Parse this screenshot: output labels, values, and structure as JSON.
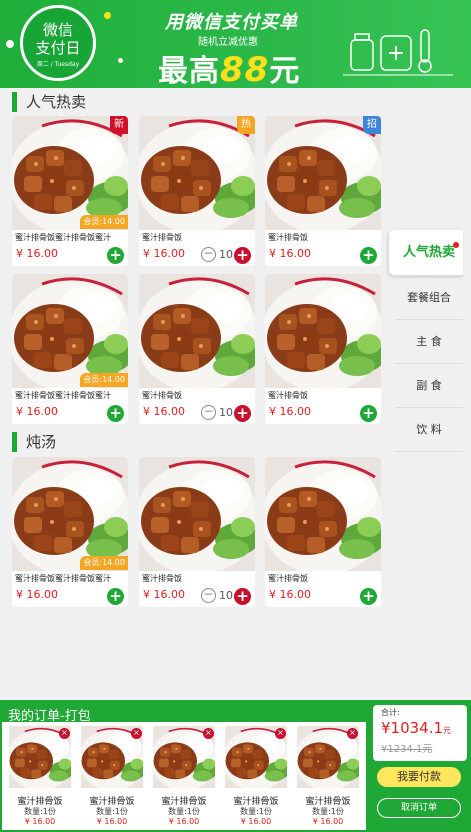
{
  "banner": {
    "badge_line1": "微信",
    "badge_line2": "支付日",
    "badge_line3": "周二 / Tuesday",
    "headline": "用微信支付买单",
    "subline": "随机立减优惠",
    "big_prefix": "最高",
    "big_number": "88",
    "big_suffix": "元"
  },
  "sections": [
    {
      "title": "人气热卖",
      "products": [
        {
          "name": "蜜汁排骨饭蜜汁排骨饭蜜汁",
          "price": "¥ 16.00",
          "tag": "新",
          "tag_color": "#d0102a",
          "member": "会员:14.00",
          "control": "add"
        },
        {
          "name": "蜜汁排骨饭",
          "price": "¥ 16.00",
          "tag": "热",
          "tag_color": "#f5a623",
          "member": "",
          "control": "stepper",
          "qty": "10"
        },
        {
          "name": "蜜汁排骨饭",
          "price": "¥ 16.00",
          "tag": "招",
          "tag_color": "#3b86d6",
          "member": "",
          "control": "add"
        },
        {
          "name": "蜜汁排骨饭蜜汁排骨饭蜜汁",
          "price": "¥ 16.00",
          "tag": "",
          "member": "会员:14.00",
          "control": "add"
        },
        {
          "name": "蜜汁排骨饭",
          "price": "¥ 16.00",
          "tag": "",
          "member": "",
          "control": "stepper",
          "qty": "10"
        },
        {
          "name": "蜜汁排骨饭",
          "price": "¥ 16.00",
          "tag": "",
          "member": "",
          "control": "add"
        }
      ]
    },
    {
      "title": "炖汤",
      "products": [
        {
          "name": "蜜汁排骨饭蜜汁排骨饭蜜汁",
          "price": "¥ 16.00",
          "tag": "",
          "member": "会员:14.00",
          "control": "add"
        },
        {
          "name": "蜜汁排骨饭",
          "price": "¥ 16.00",
          "tag": "",
          "member": "",
          "control": "stepper",
          "qty": "10"
        },
        {
          "name": "蜜汁排骨饭",
          "price": "¥ 16.00",
          "tag": "",
          "member": "",
          "control": "add"
        }
      ]
    }
  ],
  "sidenav": [
    {
      "label": "人气热卖",
      "active": true
    },
    {
      "label": "套餐组合",
      "active": false
    },
    {
      "label": "主 食",
      "active": false
    },
    {
      "label": "副 食",
      "active": false
    },
    {
      "label": "饮 料",
      "active": false
    }
  ],
  "order": {
    "title": "我的订单-打包",
    "items": [
      {
        "name": "蜜汁排骨饭",
        "qty": "数量:1份",
        "price": "¥ 16.00"
      },
      {
        "name": "蜜汁排骨饭",
        "qty": "数量:1份",
        "price": "¥ 16.00"
      },
      {
        "name": "蜜汁排骨饭",
        "qty": "数量:1份",
        "price": "¥ 16.00"
      },
      {
        "name": "蜜汁排骨饭",
        "qty": "数量:1份",
        "price": "¥ 16.00"
      },
      {
        "name": "蜜汁排骨饭",
        "qty": "数量:1份",
        "price": "¥ 16.00"
      }
    ],
    "total_label": "合计:",
    "total_amount": "¥1034.1",
    "total_unit": "元",
    "original_total": "¥1234.1元",
    "pay_label": "我要付款",
    "cancel_label": "取消订单"
  },
  "colors": {
    "brand": "#1fa836",
    "price": "#e02020"
  }
}
